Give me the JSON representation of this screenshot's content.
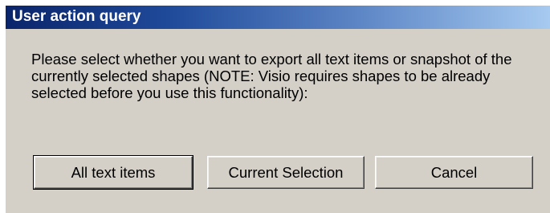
{
  "dialog": {
    "title": "User action query",
    "message": "Please select whether you want to export all text items or snapshot of the currently selected shapes (NOTE: Visio requires shapes to be already selected before you use this functionality):",
    "buttons": {
      "all_text_items": "All text items",
      "current_selection": "Current Selection",
      "cancel": "Cancel"
    }
  },
  "colors": {
    "titlebar_start": "#0a246a",
    "titlebar_end": "#a6caf0",
    "dialog_background": "#d4d0c8"
  }
}
